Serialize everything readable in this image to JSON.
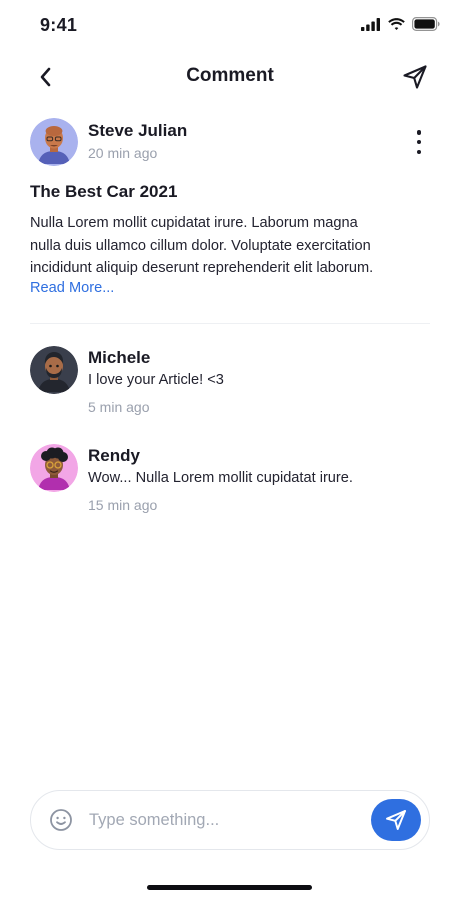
{
  "status_bar": {
    "time": "9:41"
  },
  "nav": {
    "title": "Comment"
  },
  "post": {
    "author": "Steve Julian",
    "time": "20 min ago",
    "title": "The Best Car 2021",
    "body_lines": [
      "Nulla Lorem mollit cupidatat irure. Laborum magna",
      "nulla duis ullamco cillum dolor. Voluptate exercitation",
      "incididunt aliquip deserunt reprehenderit elit laborum."
    ],
    "read_more": "Read More..."
  },
  "comments": [
    {
      "name": "Michele",
      "text": "I love your Article! <3",
      "time": "5 min ago"
    },
    {
      "name": "Rendy",
      "text": "Wow... Nulla Lorem mollit cupidatat irure.",
      "time": "15 min ago"
    }
  ],
  "composer": {
    "placeholder": "Type something..."
  },
  "colors": {
    "accent": "#2f6fe0",
    "muted": "#9aa0ad",
    "text": "#1a1a24"
  }
}
